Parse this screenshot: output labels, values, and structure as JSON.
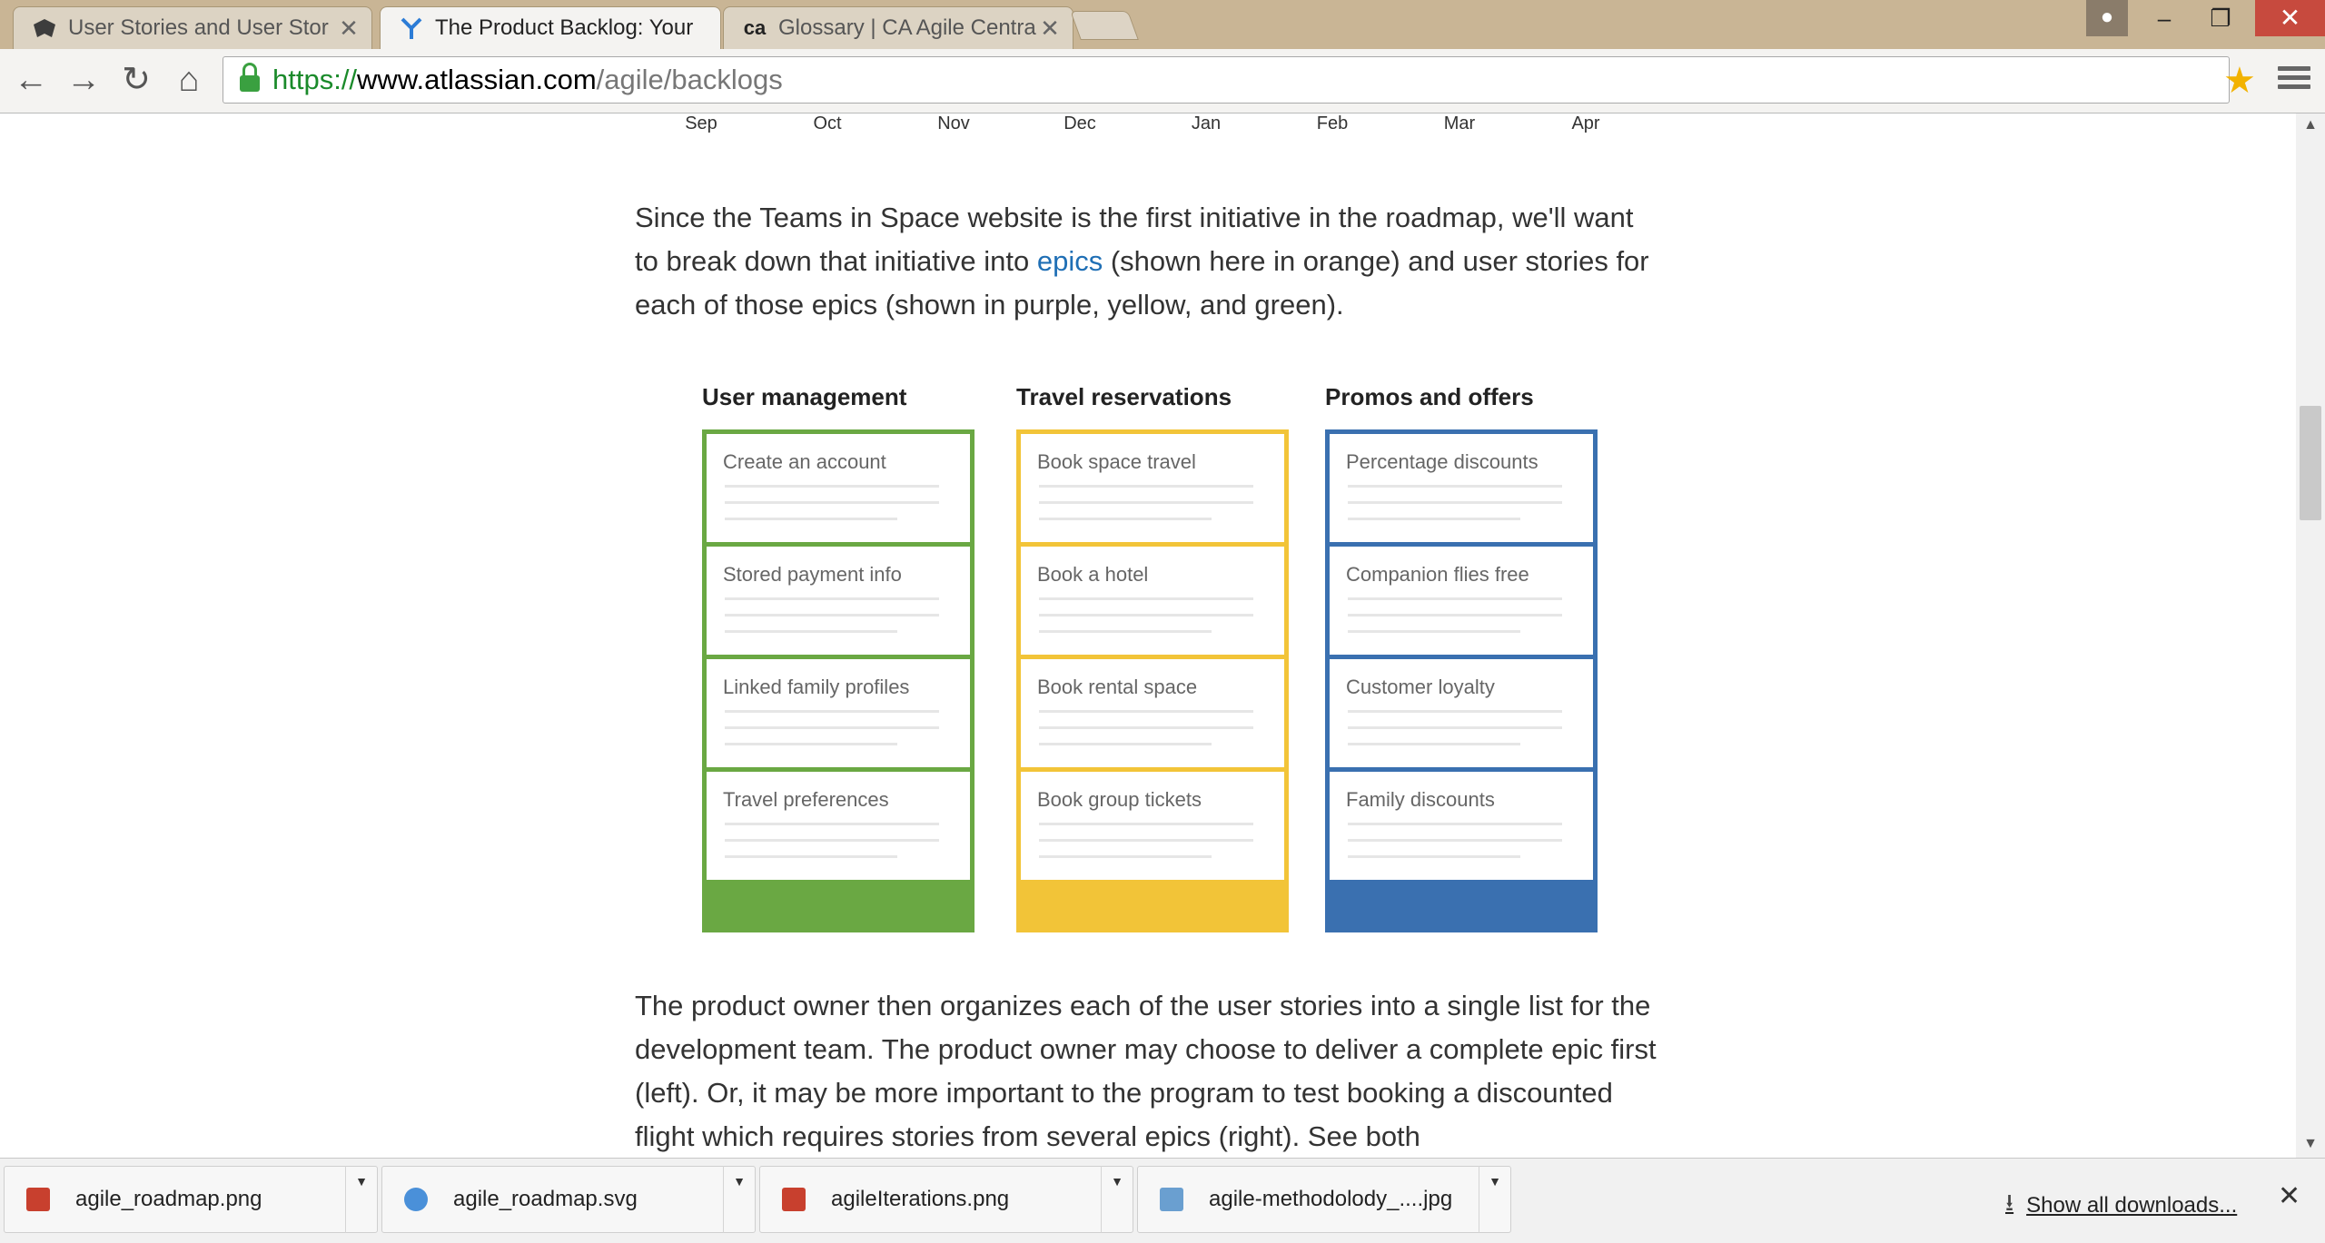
{
  "browser": {
    "tabs": [
      {
        "title": "User Stories and User Stor",
        "icon": "anteater-icon"
      },
      {
        "title": "The Product Backlog: Your",
        "icon": "atlassian-icon"
      },
      {
        "title": "Glossary | CA Agile Centra",
        "icon": "ca-icon"
      }
    ],
    "url": {
      "scheme": "https://",
      "host": "www.atlassian.com",
      "path": "/agile/backlogs"
    }
  },
  "timeline": {
    "months": [
      "Sep",
      "Oct",
      "Nov",
      "Dec",
      "Jan",
      "Feb",
      "Mar",
      "Apr"
    ]
  },
  "intro": {
    "before_link": "Since the Teams in Space website is the first initiative in the roadmap, we'll want to break down that initiative into ",
    "link": "epics",
    "after_link": " (shown here in orange) and user stories for each of those epics (shown in purple, yellow, and green)."
  },
  "epics": [
    {
      "title": "User management",
      "color": "#6aa843",
      "stories": [
        "Create an account",
        "Stored payment info",
        "Linked family profiles",
        "Travel preferences"
      ]
    },
    {
      "title": "Travel reservations",
      "color": "#f2c438",
      "stories": [
        "Book space travel",
        "Book a hotel",
        "Book rental space",
        "Book group tickets"
      ]
    },
    {
      "title": "Promos and offers",
      "color": "#3a70b0",
      "stories": [
        "Percentage discounts",
        "Companion flies free",
        "Customer loyalty",
        "Family discounts"
      ]
    }
  ],
  "outro": {
    "text": "The product owner then organizes each of the user stories into a single list for the development team. The product owner may choose to deliver a complete epic first (left). Or, it may be more important to the program to test booking a discounted flight which requires stories from several epics (right). See both"
  },
  "downloads": {
    "items": [
      "agile_roadmap.png",
      "agile_roadmap.svg",
      "agileIterations.png",
      "agile-methodolody_....jpg"
    ],
    "show_all": "Show all downloads..."
  }
}
